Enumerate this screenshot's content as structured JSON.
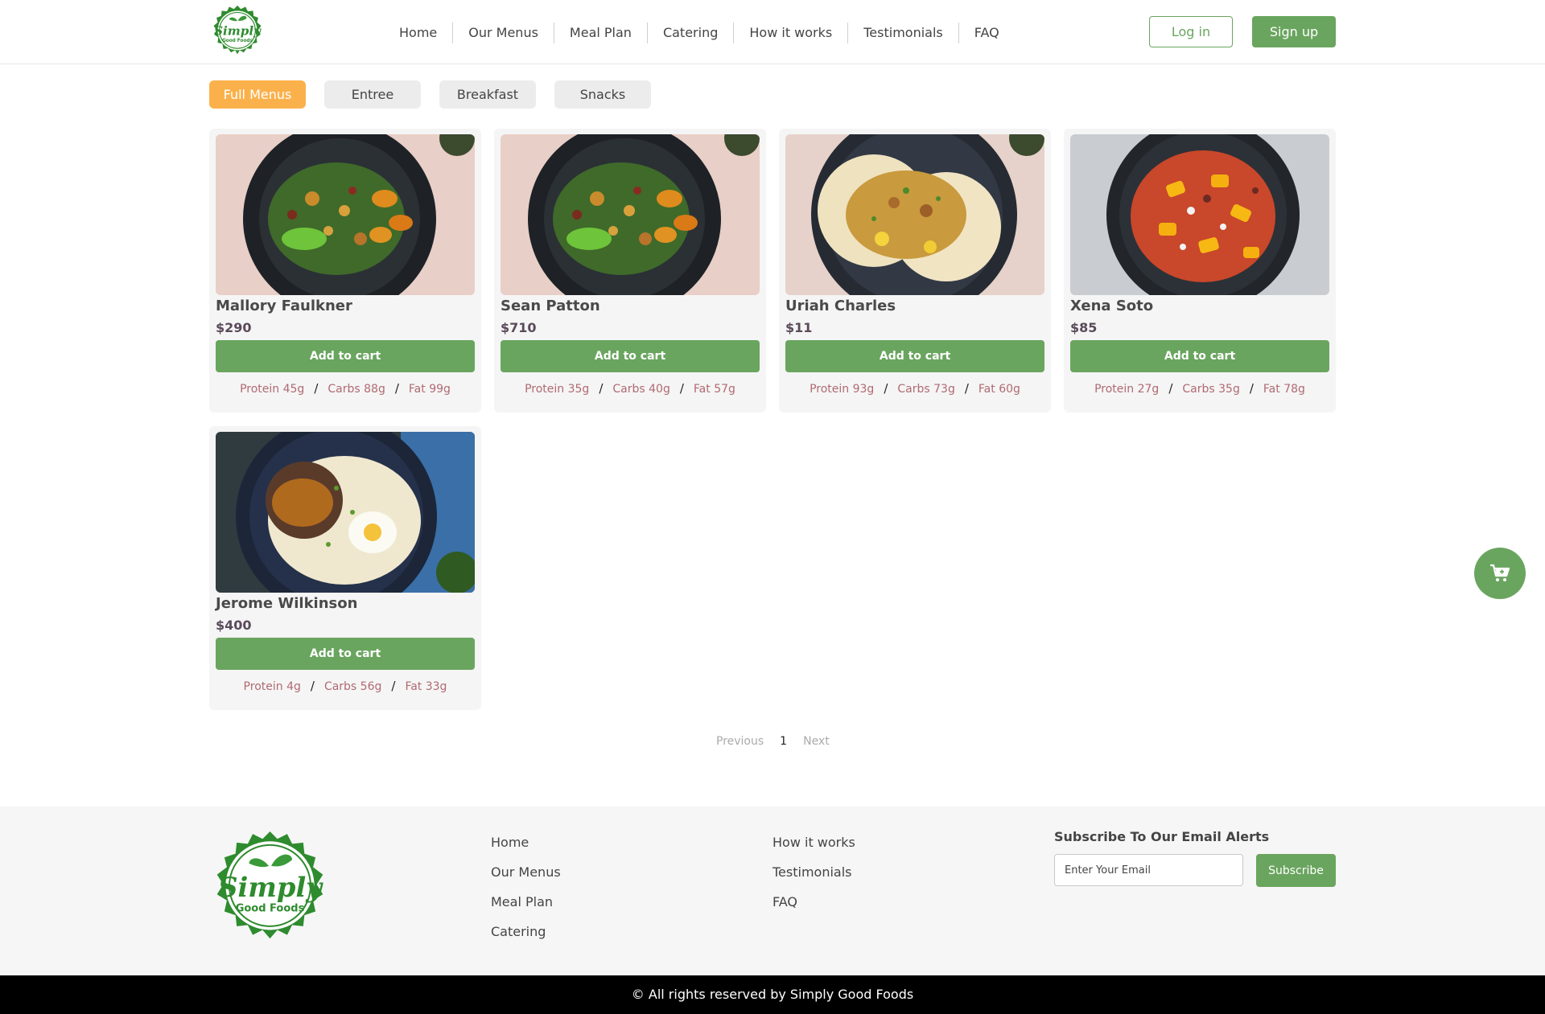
{
  "brand": {
    "name_line1": "Simply",
    "name_line2": "Good Foods"
  },
  "nav": {
    "items": [
      "Home",
      "Our Menus",
      "Meal Plan",
      "Catering",
      "How it works",
      "Testimonials",
      "FAQ"
    ],
    "login_label": "Log in",
    "signup_label": "Sign up"
  },
  "tabs": [
    {
      "label": "Full Menus",
      "active": true
    },
    {
      "label": "Entree",
      "active": false
    },
    {
      "label": "Breakfast",
      "active": false
    },
    {
      "label": "Snacks",
      "active": false
    }
  ],
  "products": [
    {
      "name": "Mallory Faulkner",
      "price": "$290",
      "cart_label": "Add to cart",
      "protein": "Protein 45g",
      "carbs": "Carbs 88g",
      "fat": "Fat 99g",
      "image": "bowl-dark-plantain"
    },
    {
      "name": "Sean Patton",
      "price": "$710",
      "cart_label": "Add to cart",
      "protein": "Protein 35g",
      "carbs": "Carbs 40g",
      "fat": "Fat 57g",
      "image": "bowl-dark-plantain"
    },
    {
      "name": "Uriah Charles",
      "price": "$11",
      "cart_label": "Add to cart",
      "protein": "Protein 93g",
      "carbs": "Carbs 73g",
      "fat": "Fat 60g",
      "image": "tortilla-plate"
    },
    {
      "name": "Xena Soto",
      "price": "$85",
      "cart_label": "Add to cart",
      "protein": "Protein 27g",
      "carbs": "Carbs 35g",
      "fat": "Fat 78g",
      "image": "red-rice-mango"
    },
    {
      "name": "Jerome Wilkinson",
      "price": "$400",
      "cart_label": "Add to cart",
      "protein": "Protein 4g",
      "carbs": "Carbs 56g",
      "fat": "Fat 33g",
      "image": "patty-rice-egg"
    }
  ],
  "pagination": {
    "previous": "Previous",
    "current": "1",
    "next": "Next"
  },
  "fab": {
    "icon": "cart-plus-icon"
  },
  "footer": {
    "col1": [
      "Home",
      "Our Menus",
      "Meal Plan",
      "Catering"
    ],
    "col2": [
      "How it works",
      "Testimonials",
      "FAQ"
    ],
    "subscribe_title": "Subscribe To Our Email Alerts",
    "email_placeholder": "Enter Your Email",
    "subscribe_label": "Subscribe",
    "copyright": "© All rights reserved by Simply Good Foods"
  },
  "colors": {
    "brand_green": "#6aa55f",
    "active_tab": "#fbb14b",
    "macro_text": "#b06a72"
  }
}
